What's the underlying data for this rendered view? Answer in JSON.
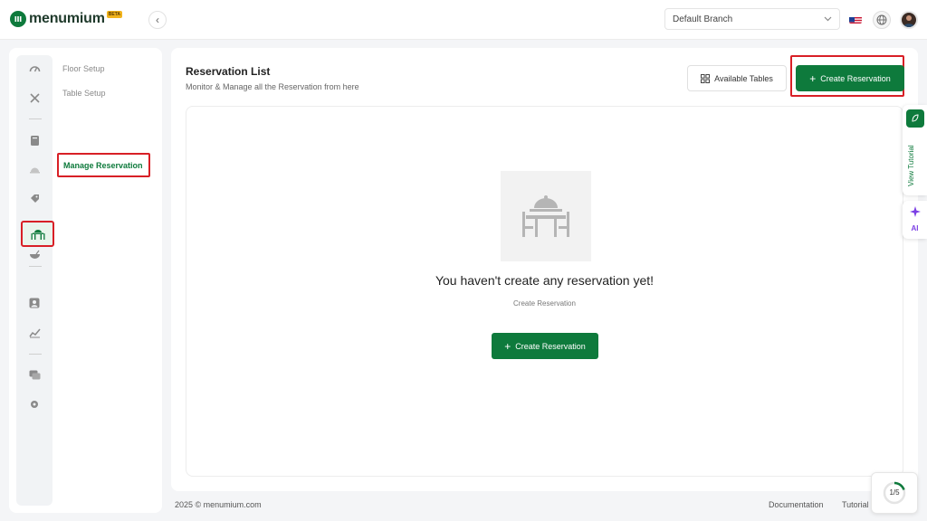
{
  "app": {
    "brand": "menumium",
    "badge": "BETA",
    "accent_color": "#0e7a3c",
    "highlight_color": "#d81f26"
  },
  "topbar": {
    "branch": "Default Branch",
    "language_flag": "us-flag-icon",
    "globe_icon": "globe-icon",
    "avatar_icon": "user-avatar"
  },
  "sidebar": {
    "submenu": [
      {
        "label": "Floor Setup"
      },
      {
        "label": "Table Setup"
      },
      {
        "label": "Manage Reservation",
        "active": true
      }
    ]
  },
  "main": {
    "title": "Reservation List",
    "subtitle": "Monitor & Manage all the Reservation from here",
    "available_tables_label": "Available Tables",
    "create_label": "Create Reservation",
    "empty_title": "You haven't create any reservation yet!",
    "empty_sub": "Create Reservation",
    "empty_button": "Create Reservation"
  },
  "right_tabs": {
    "tutorial_label": "View Tutorial",
    "ai_label": "AI"
  },
  "footer": {
    "copyright": "2025 © menumium.com",
    "documentation": "Documentation",
    "tutorial": "Tutorial",
    "progress": "1/5"
  }
}
